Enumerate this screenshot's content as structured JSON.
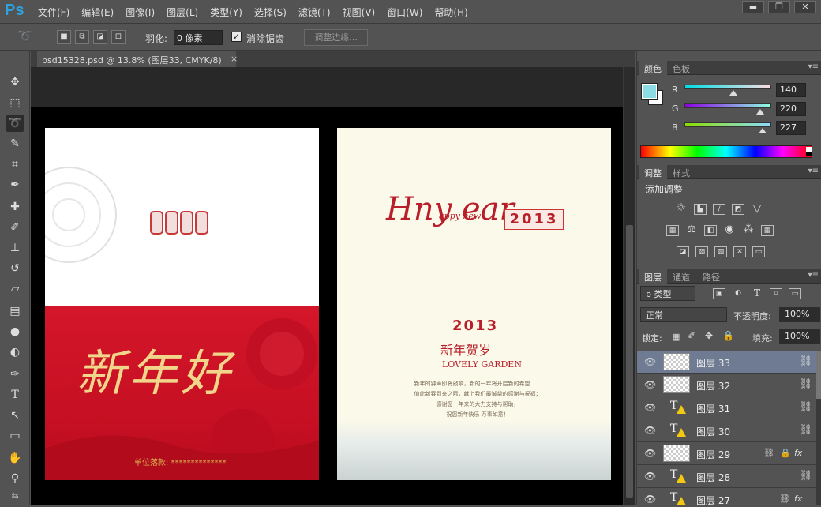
{
  "app": {
    "logo": "Ps"
  },
  "menu": [
    "文件(F)",
    "编辑(E)",
    "图像(I)",
    "图层(L)",
    "类型(Y)",
    "选择(S)",
    "滤镜(T)",
    "视图(V)",
    "窗口(W)",
    "帮助(H)"
  ],
  "window_controls": {
    "minimize": "▬",
    "restore": "❐",
    "close": "✕"
  },
  "options": {
    "feather_label": "羽化:",
    "feather_value": "0 像素",
    "antialias_label": "消除锯齿",
    "antialias_checked": "✓",
    "refine_edge": "调整边缘..."
  },
  "document": {
    "tab_title": "psd15328.psd @ 13.8% (图层33, CMYK/8)",
    "close": "×"
  },
  "artwork": {
    "left": {
      "headline": "新年好",
      "unit_line": "单位落款: **************"
    },
    "right": {
      "script_main": "Hny ear",
      "script_small": "appy new",
      "year_box": "2013",
      "year_small": "2013",
      "xinnian": "新年贺岁",
      "lovely": "LOVELY GARDEN",
      "verse": [
        "新年的钟声即将敲响，新的一年将开启新的希望……",
        "值此新春到来之际，献上我们最诚挚的感谢与祝福；",
        "感谢您一年来的大力支持与帮助，",
        "祝您新年快乐  万事如意！"
      ]
    }
  },
  "color_panel": {
    "tabs": [
      "颜色",
      "色板"
    ],
    "fg_color": "#8cdce3",
    "channels": [
      {
        "label": "R",
        "value": "140",
        "fraction": 0.55
      },
      {
        "label": "G",
        "value": "220",
        "fraction": 0.86
      },
      {
        "label": "B",
        "value": "227",
        "fraction": 0.89
      }
    ]
  },
  "adjustments_panel": {
    "tabs": [
      "调整",
      "样式"
    ],
    "title": "添加调整"
  },
  "layers_panel": {
    "tabs": [
      "图层",
      "通道",
      "路径"
    ],
    "filter_kind": "ρ 类型",
    "blend_mode": "正常",
    "opacity_label": "不透明度:",
    "opacity_value": "100%",
    "lock_label": "锁定:",
    "fill_label": "填充:",
    "fill_value": "100%",
    "layers": [
      {
        "name": "图层 33",
        "type": "pixel",
        "selected": true
      },
      {
        "name": "图层 32",
        "type": "pixel",
        "selected": false
      },
      {
        "name": "图层 31",
        "type": "text",
        "selected": false
      },
      {
        "name": "图层 30",
        "type": "text",
        "selected": false
      },
      {
        "name": "图层 29",
        "type": "pixel",
        "selected": false
      },
      {
        "name": "图层 28",
        "type": "text",
        "selected": false
      },
      {
        "name": "图层 27",
        "type": "text",
        "selected": false
      }
    ]
  }
}
